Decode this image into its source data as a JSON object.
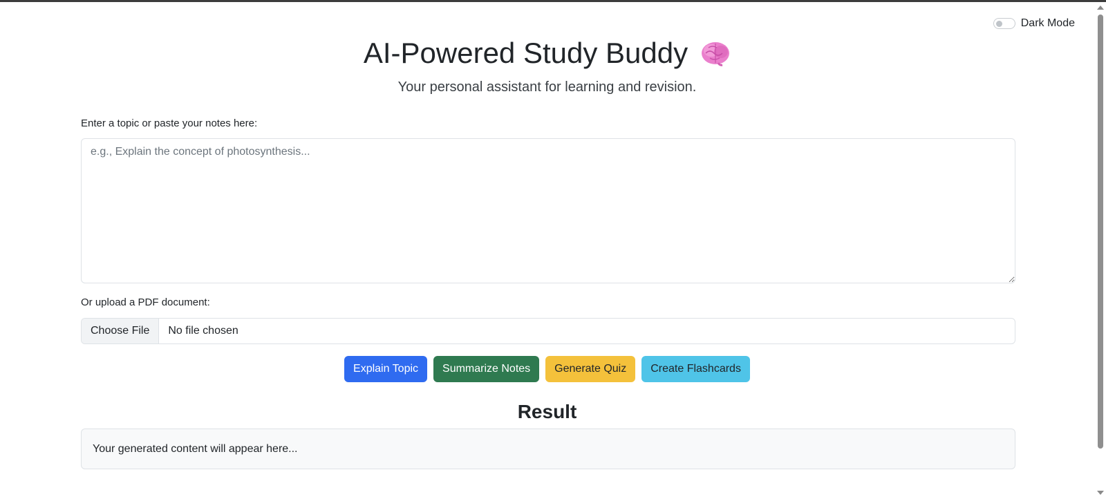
{
  "header": {
    "dark_mode_label": "Dark Mode",
    "title": "AI-Powered Study Buddy",
    "title_icon": "brain-icon",
    "subtitle": "Your personal assistant for learning and revision."
  },
  "input": {
    "notes_label": "Enter a topic or paste your notes here:",
    "notes_placeholder": "e.g., Explain the concept of photosynthesis...",
    "notes_value": "",
    "upload_label": "Or upload a PDF document:",
    "file_button": "Choose File",
    "file_status": "No file chosen"
  },
  "actions": {
    "explain": "Explain Topic",
    "summarize": "Summarize Notes",
    "quiz": "Generate Quiz",
    "flashcards": "Create Flashcards"
  },
  "result": {
    "title": "Result",
    "placeholder": "Your generated content will appear here..."
  },
  "colors": {
    "primary": "#2f6bf0",
    "success": "#2f7a50",
    "warning": "#f4c13b",
    "info": "#4fc4e8",
    "brain": "#e879c8"
  }
}
